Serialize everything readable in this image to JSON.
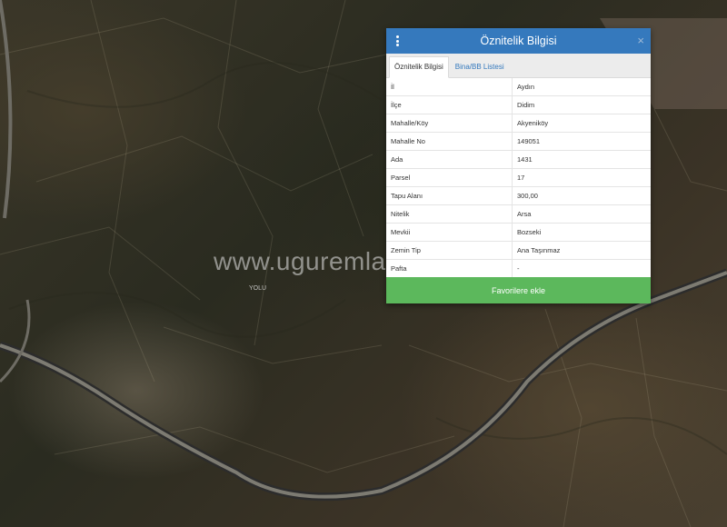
{
  "map": {
    "watermark": "www.uguremlak",
    "road_label": "YOLU"
  },
  "panel": {
    "title": "Öznitelik Bilgisi",
    "close_symbol": "×",
    "menu_icon": "vertical-ellipsis-icon",
    "tabs": [
      {
        "label": "Öznitelik Bilgisi",
        "active": true
      },
      {
        "label": "Bina/BB Listesi",
        "active": false
      }
    ],
    "attributes": [
      {
        "key": "İl",
        "value": "Aydın"
      },
      {
        "key": "İlçe",
        "value": "Didim"
      },
      {
        "key": "Mahalle/Köy",
        "value": "Akyeniköy"
      },
      {
        "key": "Mahalle No",
        "value": "149051"
      },
      {
        "key": "Ada",
        "value": "1431"
      },
      {
        "key": "Parsel",
        "value": "17"
      },
      {
        "key": "Tapu Alanı",
        "value": "300,00"
      },
      {
        "key": "Nitelik",
        "value": "Arsa"
      },
      {
        "key": "Mevkii",
        "value": "Bozseki"
      },
      {
        "key": "Zemin Tip",
        "value": "Ana Taşınmaz"
      },
      {
        "key": "Pafta",
        "value": "-"
      }
    ],
    "favorite_button": "Favorilere ekle"
  },
  "colors": {
    "header": "#3579bd",
    "button": "#5cb85c"
  }
}
